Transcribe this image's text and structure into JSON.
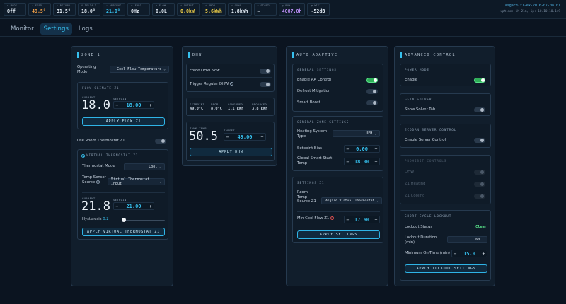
{
  "stats": [
    {
      "icon": "mode-icon",
      "glyph": "⚙",
      "label": "MODE",
      "value": "Off",
      "color": "#e3ecf5"
    },
    {
      "icon": "feed-icon",
      "glyph": "⇡",
      "label": "FEED",
      "value": "49.5°",
      "color": "#f0a048"
    },
    {
      "icon": "return-icon",
      "glyph": "⇣",
      "label": "RETURN",
      "value": "31.5°",
      "color": "#e3ecf5"
    },
    {
      "icon": "delta-icon",
      "glyph": "Δ",
      "label": "DELTA T",
      "value": "18.0°",
      "color": "#e3ecf5"
    },
    {
      "icon": "thermometer-icon",
      "glyph": "◦",
      "label": "AMBIENT",
      "value": "21.0°",
      "color": "#36c0ee"
    },
    {
      "icon": "freq-icon",
      "glyph": "∿",
      "label": "FREQ",
      "value": "0Hz",
      "color": "#e3ecf5"
    },
    {
      "icon": "flow-icon",
      "glyph": "≈",
      "label": "FLOW",
      "value": "0.0L",
      "color": "#e3ecf5"
    },
    {
      "icon": "output-icon",
      "glyph": "⚡",
      "label": "OUTPUT",
      "value": "0.0kW",
      "color": "#f0d048"
    },
    {
      "icon": "prod-icon",
      "glyph": "⚡",
      "label": "PROD",
      "value": "5.6kWh",
      "color": "#f0d048"
    },
    {
      "icon": "cons-icon",
      "glyph": "⚡",
      "label": "CONS",
      "value": "1.8kWh",
      "color": "#e3ecf5"
    },
    {
      "icon": "starts-icon",
      "glyph": "↻",
      "label": "STARTS",
      "value": "—",
      "color": "#e3ecf5"
    },
    {
      "icon": "run-icon",
      "glyph": "◷",
      "label": "RUN",
      "value": "4087.0h",
      "color": "#b68cf0"
    },
    {
      "icon": "wifi-icon",
      "glyph": "◔",
      "label": "WIFI",
      "value": "-52dB",
      "color": "#e3ecf5"
    }
  ],
  "device": {
    "name": "asgard-z1-ex-2016-07-08.01",
    "meta": "uptime: 1h 21m, ip: 10.10.10.149"
  },
  "tabs": [
    "Monitor",
    "Settings",
    "Logs"
  ],
  "zone1": {
    "title": "ZONE 1",
    "operating_mode_label": "Operating Mode",
    "operating_mode_value": "Cool Flow Temperature",
    "flow_climate_title": "FLOW CLIMATE Z1",
    "current_label": "CURRENT",
    "current_value": "18.0",
    "setpoint_label": "SETPOINT",
    "setpoint_value": "18.00",
    "apply_flow": "APPLY FLOW Z1",
    "use_room_thermostat": "Use Room Thermostat Z1",
    "vt_title": "VIRTUAL THERMOSTAT Z1",
    "thermostat_mode_label": "Thermostat Mode",
    "thermostat_mode_value": "Cool",
    "temp_source_label": "Temp Sensor Source",
    "temp_source_value": "Virtual Thermostat Input",
    "vt_current_value": "21.8",
    "vt_setpoint_value": "21.00",
    "hysteresis_label": "Hysteresis",
    "hysteresis_value": "0.2",
    "hysteresis_fraction": 0.05,
    "apply_vt": "APPLY VIRTUAL THERMOSTAT Z1"
  },
  "dhw": {
    "title": "DHW",
    "force_label": "Force DHW Now",
    "trigger_label": "Trigger Regular DHW",
    "metrics": [
      {
        "label": "SETPOINT",
        "value": "49.0°C"
      },
      {
        "label": "DROP",
        "value": "8.0°C"
      },
      {
        "label": "CONSUMED",
        "value": "1.1 kWh"
      },
      {
        "label": "PRODUCED",
        "value": "3.8 kWh"
      }
    ],
    "tank_temp_label": "TANK TEMP",
    "tank_temp_value": "50.5",
    "target_label": "TARGET",
    "target_value": "49.00",
    "apply": "APPLY DHW"
  },
  "auto_adaptive": {
    "title": "AUTO ADAPTIVE",
    "general_title": "GENERAL SETTINGS",
    "enable_aa": "Enable AA Control",
    "defrost": "Defrost Mitigation",
    "smart_boost": "Smart Boost",
    "general_zone_title": "GENERAL ZONE SETTINGS",
    "heating_system_label": "Heating System Type",
    "heating_system_value": "UFH",
    "setpoint_bias_label": "Setpoint Bias",
    "setpoint_bias_value": "0.00",
    "global_smart_label": "Global Smart Start Temp",
    "global_smart_value": "18.00",
    "settings_z1_title": "SETTINGS Z1",
    "room_temp_source_label": "Room Temp Source Z1",
    "room_temp_source_value": "Asgard Virtual Thermostat",
    "min_cool_flow_label": "Min Cool Flow Z1",
    "min_cool_flow_value": "17.60",
    "apply": "APPLY SETTINGS"
  },
  "advanced": {
    "title": "ADVANCED CONTROL",
    "power_mode_title": "POWER MODE",
    "enable_label": "Enable",
    "gein_title": "GEIN SOLVER",
    "show_solver_label": "Show Solver Tab",
    "ecodan_title": "ECODAN SERVER CONTROL",
    "enable_server_label": "Enable Server Control",
    "prohibit_title": "PROHIBIT CONTROLS",
    "prohibit_dhw": "DHW",
    "prohibit_heating": "Z1 Heating",
    "prohibit_cooling": "Z1 Cooling",
    "short_cycle_title": "SHORT CYCLE LOCKOUT",
    "lockout_status_label": "Lockout Status",
    "lockout_status_value": "Clear",
    "lockout_duration_label": "Lockout Duration (min)",
    "lockout_duration_value": "60",
    "min_on_time_label": "Minimum On-Time (min)",
    "min_on_time_value": "15.0",
    "apply": "APPLY LOCKOUT SETTINGS"
  },
  "colors": {
    "accent": "#36c0ee",
    "toggle_on": "#2fae58",
    "clear_status": "#59e38a",
    "help_red": "#e05050"
  }
}
